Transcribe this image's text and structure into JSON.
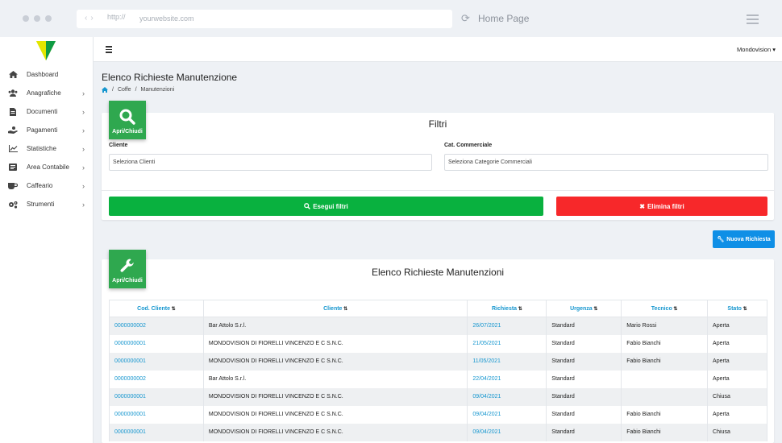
{
  "browser": {
    "url_scheme": "http://",
    "url_site": "yourwebsite.com",
    "page_title": "Home Page"
  },
  "sidebar": {
    "items": [
      {
        "label": "Dashboard",
        "icon": "home-icon",
        "has_chevron": false
      },
      {
        "label": "Anagrafiche",
        "icon": "users-icon",
        "has_chevron": true
      },
      {
        "label": "Documenti",
        "icon": "file-icon",
        "has_chevron": true
      },
      {
        "label": "Pagamenti",
        "icon": "hand-coin-icon",
        "has_chevron": true
      },
      {
        "label": "Statistiche",
        "icon": "chart-icon",
        "has_chevron": true
      },
      {
        "label": "Area Contabile",
        "icon": "ledger-icon",
        "has_chevron": true
      },
      {
        "label": "Caffeario",
        "icon": "coffee-icon",
        "has_chevron": true
      },
      {
        "label": "Strumenti",
        "icon": "cogs-icon",
        "has_chevron": true
      }
    ]
  },
  "topbar": {
    "user": "Mondovision"
  },
  "page": {
    "title": "Elenco Richieste Manutenzione",
    "breadcrumb": [
      "Coffe",
      "Manutenzioni"
    ]
  },
  "filters": {
    "toggle_label": "Apri/Chiudi",
    "title": "Filtri",
    "cliente_label": "Cliente",
    "cliente_placeholder": "Seleziona Clienti",
    "categoria_label": "Cat. Commerciale",
    "categoria_placeholder": "Seleziona Categorie Commerciali",
    "apply_label": "Esegui filtri",
    "clear_label": "Elimina filtri"
  },
  "new_request_label": "Nuova Richiesta",
  "list": {
    "toggle_label": "Apri/Chiudi",
    "title": "Elenco Richieste Manutenzioni",
    "columns": [
      "Cod. Cliente",
      "Cliente",
      "Richiesta",
      "Urgenza",
      "Tecnico",
      "Stato"
    ],
    "rows": [
      [
        "0000000002",
        "Bar Attolo S.r.l.",
        "26/07/2021",
        "Standard",
        "Mario Rossi",
        "Aperta"
      ],
      [
        "0000000001",
        "MONDOVISION DI FIORELLI VINCENZO E C S.N.C.",
        "21/05/2021",
        "Standard",
        "Fabio Bianchi",
        "Aperta"
      ],
      [
        "0000000001",
        "MONDOVISION DI FIORELLI VINCENZO E C S.N.C.",
        "11/05/2021",
        "Standard",
        "Fabio Bianchi",
        "Aperta"
      ],
      [
        "0000000002",
        "Bar Attolo S.r.l.",
        "22/04/2021",
        "Standard",
        "",
        "Aperta"
      ],
      [
        "0000000001",
        "MONDOVISION DI FIORELLI VINCENZO E C S.N.C.",
        "09/04/2021",
        "Standard",
        "",
        "Chiusa"
      ],
      [
        "0000000001",
        "MONDOVISION DI FIORELLI VINCENZO E C S.N.C.",
        "09/04/2021",
        "Standard",
        "Fabio Bianchi",
        "Aperta"
      ],
      [
        "0000000001",
        "MONDOVISION DI FIORELLI VINCENZO E C S.N.C.",
        "09/04/2021",
        "Standard",
        "Fabio Bianchi",
        "Chiusa"
      ]
    ]
  },
  "colors": {
    "green_badge": "#2fa84f",
    "apply_button": "#09b13f",
    "clear_button": "#f7282a",
    "new_button": "#0f8fe6",
    "link": "#1596cf"
  }
}
